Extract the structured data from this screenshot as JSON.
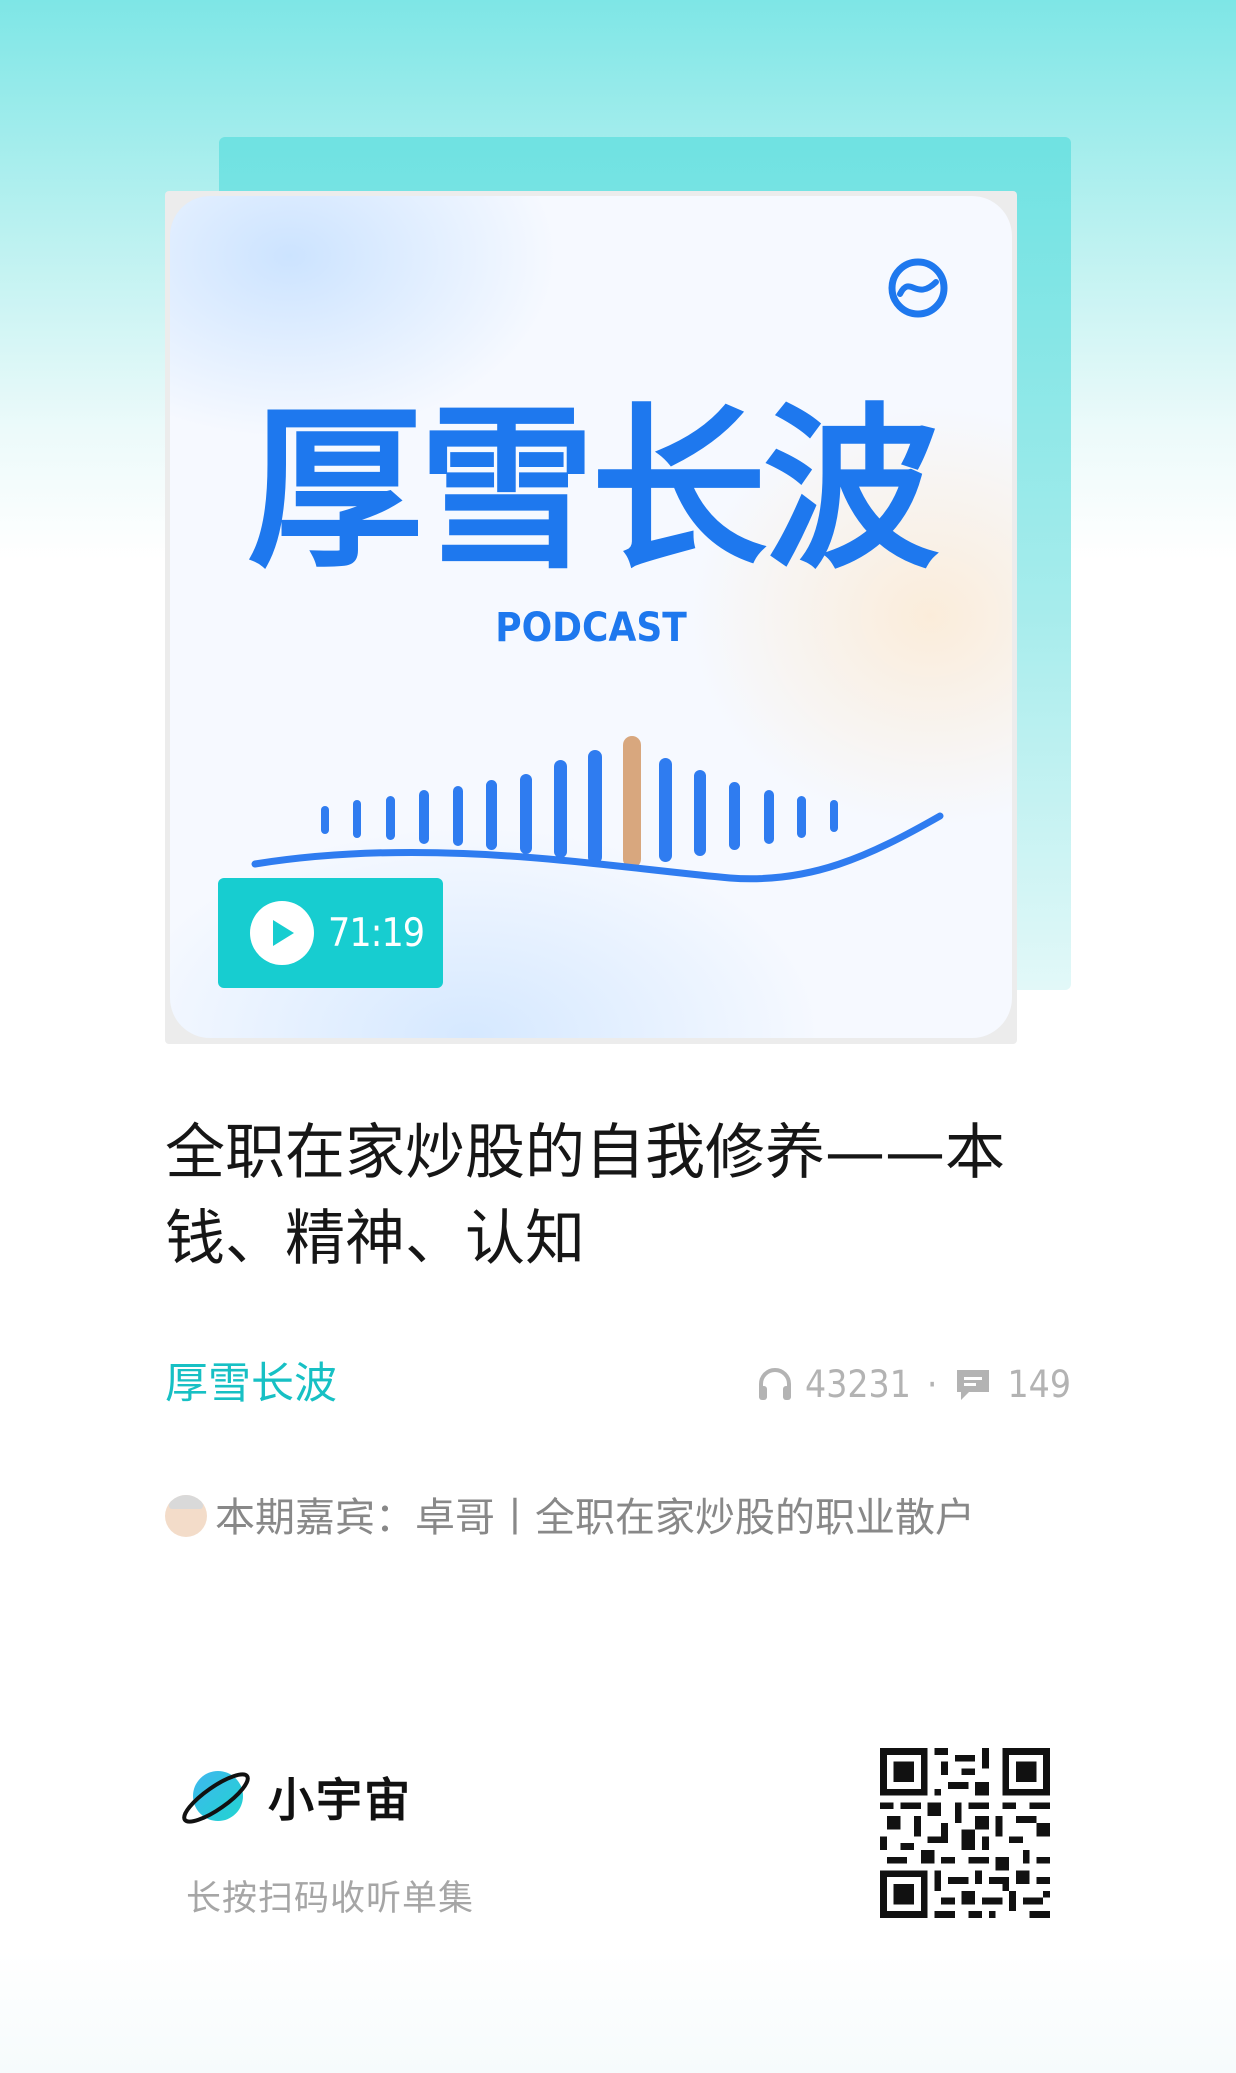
{
  "cover": {
    "title": "厚雪长波",
    "subtitle": "PODCAST",
    "duration": "71:19"
  },
  "episode": {
    "title": "全职在家炒股的自我修养——本钱、精神、认知"
  },
  "podcast": {
    "name": "厚雪长波"
  },
  "stats": {
    "plays": "43231",
    "separator": "·",
    "comments": "149"
  },
  "guest": {
    "text": "本期嘉宾：卓哥丨全职在家炒股的职业散户"
  },
  "brand": {
    "name": "小宇宙",
    "hint": "长按扫码收听单集"
  },
  "colors": {
    "accent": "#17cdd0",
    "cover_blue": "#1e78ee"
  },
  "icons": [
    "play-icon",
    "headphones-icon",
    "comment-icon",
    "planet-logo-icon",
    "qr-code-icon"
  ]
}
